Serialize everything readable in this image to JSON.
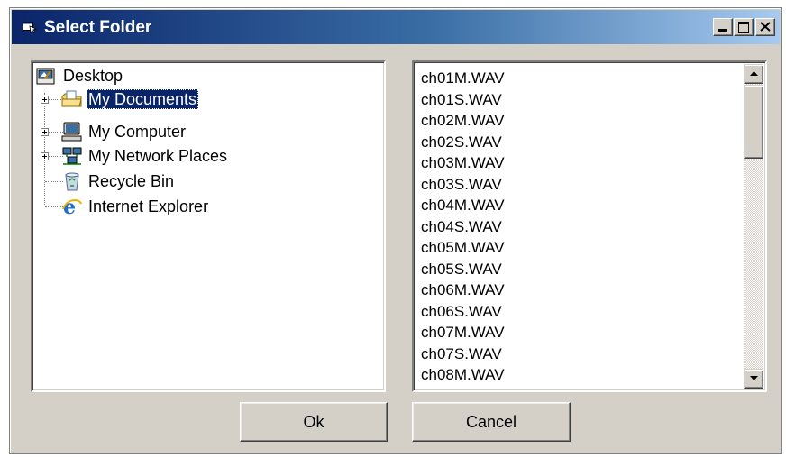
{
  "window": {
    "title": "Select Folder",
    "icon": "folder-dialog-icon",
    "caption_buttons": [
      "minimize-icon",
      "maximize-icon",
      "close-icon"
    ]
  },
  "tree": {
    "root": {
      "label": "Desktop",
      "icon": "desktop-icon"
    },
    "items": [
      {
        "label": "My Documents",
        "icon": "my-documents-icon",
        "expandable": true,
        "selected": true
      },
      {
        "label": "My Computer",
        "icon": "my-computer-icon",
        "expandable": true,
        "selected": false
      },
      {
        "label": "My Network Places",
        "icon": "network-places-icon",
        "expandable": true,
        "selected": false
      },
      {
        "label": "Recycle Bin",
        "icon": "recycle-bin-icon",
        "expandable": false,
        "selected": false
      },
      {
        "label": "Internet Explorer",
        "icon": "internet-explorer-icon",
        "expandable": false,
        "selected": false
      }
    ]
  },
  "files": [
    "ch01M.WAV",
    "ch01S.WAV",
    "ch02M.WAV",
    "ch02S.WAV",
    "ch03M.WAV",
    "ch03S.WAV",
    "ch04M.WAV",
    "ch04S.WAV",
    "ch05M.WAV",
    "ch05S.WAV",
    "ch06M.WAV",
    "ch06S.WAV",
    "ch07M.WAV",
    "ch07S.WAV",
    "ch08M.WAV"
  ],
  "buttons": {
    "ok_label": "Ok",
    "cancel_label": "Cancel"
  },
  "colors": {
    "titlebar_start": "#0a246a",
    "titlebar_end": "#a6caf0",
    "selection": "#0a246a",
    "face": "#d4d0c8"
  }
}
